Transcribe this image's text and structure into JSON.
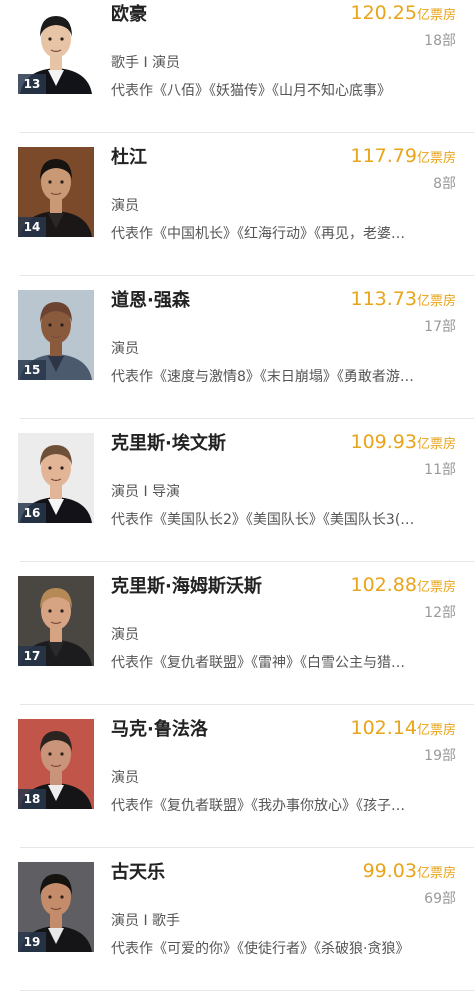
{
  "items": [
    {
      "rank": "13",
      "name": "欧豪",
      "box_office": "120.25",
      "unit": "亿票房",
      "films": "18部",
      "role": "歌手 I 演员",
      "works": "代表作《八佰》《妖猫传》《山月不知心底事》",
      "skin": "#e7c4a6",
      "hair": "#1b1b1b",
      "bg": "#ffffff",
      "suit": "#121318",
      "shirt": "#f4f4f4"
    },
    {
      "rank": "14",
      "name": "杜江",
      "box_office": "117.79",
      "unit": "亿票房",
      "films": "8部",
      "role": "演员",
      "works": "代表作《中国机长》《红海行动》《再见，老婆…",
      "skin": "#c99874",
      "hair": "#161311",
      "bg": "#7a4a2a",
      "suit": "#1b1717",
      "shirt": "#2a2626"
    },
    {
      "rank": "15",
      "name": "道恩·强森",
      "box_office": "113.73",
      "unit": "亿票房",
      "films": "17部",
      "role": "演员",
      "works": "代表作《速度与激情8》《末日崩塌》《勇敢者游…",
      "skin": "#8a5a3d",
      "hair": "#6b4330",
      "bg": "#b9c5cf",
      "suit": "#4c5a6e",
      "shirt": "#2d3646"
    },
    {
      "rank": "16",
      "name": "克里斯·埃文斯",
      "box_office": "109.93",
      "unit": "亿票房",
      "films": "11部",
      "role": "演员 I 导演",
      "works": "代表作《美国队长2》《美国队长》《美国队长3(…",
      "skin": "#e3b597",
      "hair": "#6e5038",
      "bg": "#ececec",
      "suit": "#121218",
      "shirt": "#f7f7f7"
    },
    {
      "rank": "17",
      "name": "克里斯·海姆斯沃斯",
      "box_office": "102.88",
      "unit": "亿票房",
      "films": "12部",
      "role": "演员",
      "works": "代表作《复仇者联盟》《雷神》《白雪公主与猎…",
      "skin": "#d6a383",
      "hair": "#b68a54",
      "bg": "#4a4743",
      "suit": "#1c1c1e",
      "shirt": "#2a2a2c"
    },
    {
      "rank": "18",
      "name": "马克·鲁法洛",
      "box_office": "102.14",
      "unit": "亿票房",
      "films": "19部",
      "role": "演员",
      "works": "代表作《复仇者联盟》《我办事你放心》《孩子…",
      "skin": "#c99479",
      "hair": "#2a2320",
      "bg": "#c2554a",
      "suit": "#151517",
      "shirt": "#ededed"
    },
    {
      "rank": "19",
      "name": "古天乐",
      "box_office": "99.03",
      "unit": "亿票房",
      "films": "69部",
      "role": "演员 I 歌手",
      "works": "代表作《可爱的你》《使徒行者》《杀破狼·贪狼》",
      "skin": "#c48c6a",
      "hair": "#151210",
      "bg": "#5f5f63",
      "suit": "#151517",
      "shirt": "#e9e9e9"
    }
  ]
}
